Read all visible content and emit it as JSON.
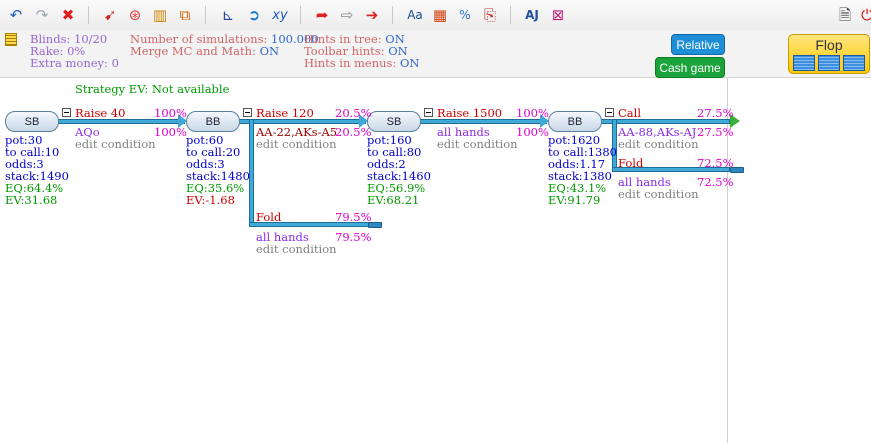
{
  "toolbar": {
    "icons": [
      "undo-icon",
      "redo-icon",
      "delete-icon",
      "solve-icon",
      "cc-icon",
      "stats-icon",
      "export-icon",
      "axis-icon",
      "forward-icon",
      "xy-icon",
      "red-arrow-icon",
      "white-arrow-icon",
      "red-arrow-right-icon",
      "text-icon",
      "grid-icon",
      "table-icon",
      "paste-icon",
      "compare-icon",
      "ai-icon",
      "doc-icon",
      "exit-icon"
    ]
  },
  "info": {
    "blinds_label": "Blinds:",
    "blinds_value": "10/20",
    "rake_label": "Rake:",
    "rake_value": "0%",
    "extra_label": "Extra money:",
    "extra_value": "0",
    "sims_label": "Number of simulations:",
    "sims_value": "100.000",
    "merge_label": "Merge MC and Math:",
    "merge_value": "ON",
    "hints_tree_label": "Hints in tree:",
    "hints_tree_value": "ON",
    "toolbar_hints_label": "Toolbar hints:",
    "toolbar_hints_value": "ON",
    "hints_menus_label": "Hints in menus:",
    "hints_menus_value": "ON",
    "relative_btn": "Relative",
    "cash_btn": "Cash game",
    "flop_btn": "Flop"
  },
  "tree": {
    "strategy_ev": "Strategy EV: Not available",
    "nodes": [
      {
        "label": "SB",
        "stats": {
          "pot": "pot:30",
          "tocall": "to call:10",
          "odds": "odds:3",
          "stack": "stack:1490",
          "eq": "EQ:64.4%",
          "ev": "EV:31.68"
        }
      },
      {
        "label": "BB",
        "stats": {
          "pot": "pot:60",
          "tocall": "to call:20",
          "odds": "odds:3",
          "stack": "stack:1480",
          "eq": "EQ:35.6%",
          "ev": "EV:-1.68"
        }
      },
      {
        "label": "SB",
        "stats": {
          "pot": "pot:160",
          "tocall": "to call:80",
          "odds": "odds:2",
          "stack": "stack:1460",
          "eq": "EQ:56.9%",
          "ev": "EV:68.21"
        }
      },
      {
        "label": "BB",
        "stats": {
          "pot": "pot:1620",
          "tocall": "to call:1380",
          "odds": "odds:1.17",
          "stack": "stack:1380",
          "eq": "EQ:43.1%",
          "ev": "EV:91.79"
        }
      }
    ],
    "actions": [
      {
        "name": "Raise 40",
        "pct": "100%",
        "range": "AQo",
        "range_pct": "100%",
        "edit": "edit condition"
      },
      {
        "name": "Raise 120",
        "pct": "20.5%",
        "range": "AA-22,AKs-A5",
        "range_pct": "20.5%",
        "edit": "edit condition"
      },
      {
        "name": "Fold",
        "pct": "79.5%",
        "range": "all hands",
        "range_pct": "79.5%",
        "edit": "edit condition"
      },
      {
        "name": "Raise 1500",
        "pct": "100%",
        "range": "all hands",
        "range_pct": "100%",
        "edit": "edit condition"
      },
      {
        "name": "Call",
        "pct": "27.5%",
        "range": "AA-88,AKs-AJ",
        "range_pct": "27.5%",
        "edit": "edit condition"
      },
      {
        "name": "Fold",
        "pct": "72.5%",
        "range": "all hands",
        "range_pct": "72.5%",
        "edit": "edit condition"
      }
    ]
  },
  "colors": {
    "accent_blue": "#3fa9d8",
    "relative_bg": "#1e8fd6",
    "cash_bg": "#1aa33a",
    "flop_bg": "#ffc800"
  }
}
